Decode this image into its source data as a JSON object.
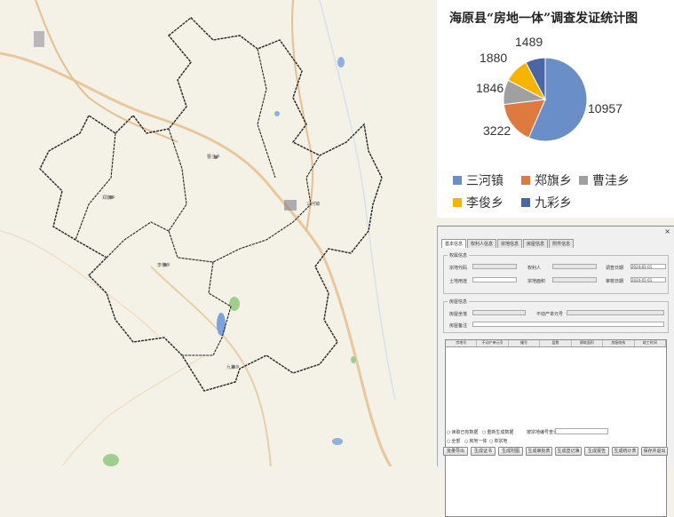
{
  "chart_panel": {
    "title": "海原县“房地一体”调查发证统计图"
  },
  "chart_data": {
    "type": "pie",
    "title": "海原县“房地一体”调查发证统计图",
    "categories": [
      "三河镇",
      "郑旗乡",
      "曹洼乡",
      "李俊乡",
      "九彩乡"
    ],
    "values": [
      10957,
      3222,
      1846,
      1880,
      1489
    ],
    "colors": [
      "#6a8fc8",
      "#de7a3f",
      "#a0a0a0",
      "#f5b400",
      "#4a66a5"
    ],
    "legend_position": "bottom"
  },
  "map": {
    "labels": [
      "三河镇",
      "郑旗乡",
      "曹洼乡",
      "李俊乡",
      "九彩乡"
    ]
  },
  "dialog": {
    "close": "×",
    "tabs": [
      "基本信息",
      "权利人信息",
      "宗地信息",
      "房屋信息",
      "附件信息"
    ],
    "group1": {
      "label": "权属信息",
      "fields": [
        "宗地代码",
        "权利人",
        "土地用途",
        "宗地面积",
        "调查日期",
        "调查人",
        "审核日期",
        "审核人"
      ],
      "dates": [
        "2024-01-01",
        "2024-01-01"
      ]
    },
    "group2": {
      "label": "房屋信息",
      "fields": [
        "房屋坐落",
        "不动产单元号",
        "房屋备注"
      ]
    },
    "grid_headers": [
      "宗地号",
      "不动产单元号",
      "幢号",
      "层数",
      "建筑面积",
      "房屋结构",
      "竣工时间"
    ],
    "radios_row1": [
      "读取已有数据",
      "重新生成数据"
    ],
    "radios_row2": [
      "全部",
      "房地一体",
      "单宗地"
    ],
    "search_label": "按宗地编号查询",
    "buttons": [
      "批量导出",
      "生成证书",
      "生成附图",
      "生成审批表",
      "生成登记簿",
      "生成报告",
      "生成统计表",
      "保存并退出"
    ]
  }
}
